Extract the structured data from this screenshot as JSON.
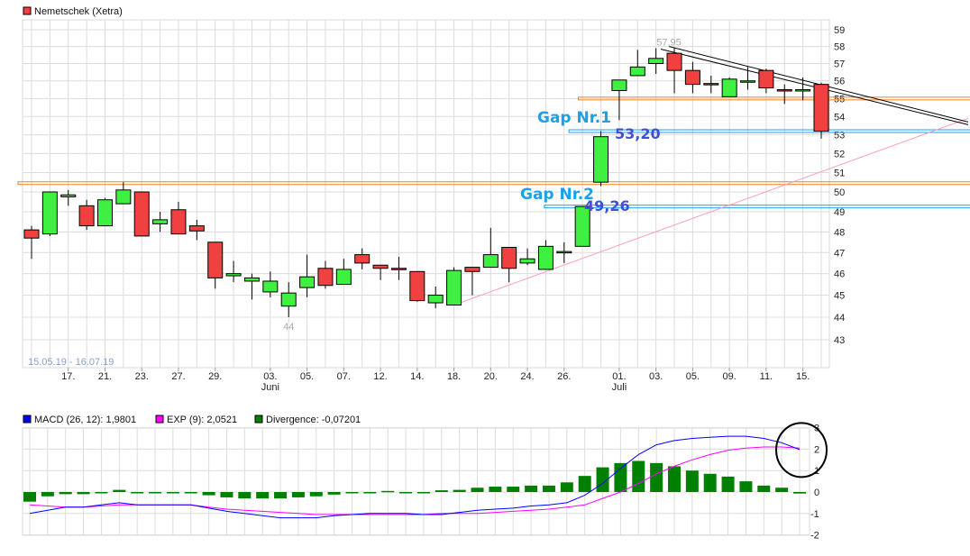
{
  "chart_data": [
    {
      "type": "candlestick",
      "legend": {
        "label": "Nemetschek (Xetra)",
        "color": "#f04040"
      },
      "date_range_label": "15.05.19 - 16.07.19",
      "y_scale": "log",
      "ylim": [
        42,
        59.5
      ],
      "y_ticks": [
        43,
        44,
        45,
        46,
        47,
        48,
        49,
        50,
        51,
        52,
        53,
        54,
        55,
        56,
        57,
        58,
        59
      ],
      "grid": true,
      "x_tick_labels": [
        {
          "i": 2,
          "label": "17."
        },
        {
          "i": 4,
          "label": "21."
        },
        {
          "i": 6,
          "label": "23."
        },
        {
          "i": 8,
          "label": "27."
        },
        {
          "i": 10,
          "label": "29."
        },
        {
          "i": 13,
          "label": "03."
        },
        {
          "i": 15,
          "label": "05."
        },
        {
          "i": 17,
          "label": "07."
        },
        {
          "i": 19,
          "label": "12."
        },
        {
          "i": 21,
          "label": "14."
        },
        {
          "i": 23,
          "label": "18."
        },
        {
          "i": 25,
          "label": "20."
        },
        {
          "i": 27,
          "label": "24."
        },
        {
          "i": 29,
          "label": "26."
        },
        {
          "i": 32,
          "label": "01."
        },
        {
          "i": 34,
          "label": "03."
        },
        {
          "i": 36,
          "label": "05."
        },
        {
          "i": 38,
          "label": "09."
        },
        {
          "i": 40,
          "label": "11."
        },
        {
          "i": 42,
          "label": "15."
        }
      ],
      "month_labels": [
        {
          "i": 13,
          "label": "Juni"
        },
        {
          "i": 32,
          "label": "Juli"
        }
      ],
      "up_color": "#40f040",
      "down_color": "#f04040",
      "ohlc": [
        [
          48.1,
          48.3,
          46.7,
          47.7
        ],
        [
          47.9,
          50.0,
          47.8,
          50.0
        ],
        [
          49.75,
          50.1,
          49.3,
          49.85
        ],
        [
          49.3,
          49.6,
          48.1,
          48.3
        ],
        [
          48.3,
          49.7,
          48.3,
          49.6
        ],
        [
          49.4,
          50.5,
          49.4,
          50.1
        ],
        [
          50.0,
          50.0,
          47.8,
          47.8
        ],
        [
          48.4,
          49.0,
          48.0,
          48.6
        ],
        [
          49.1,
          49.5,
          47.9,
          47.9
        ],
        [
          48.3,
          48.6,
          47.6,
          48.05
        ],
        [
          47.5,
          47.5,
          45.3,
          45.8
        ],
        [
          45.9,
          46.6,
          45.6,
          46.0
        ],
        [
          45.65,
          46.0,
          44.8,
          45.8
        ],
        [
          45.15,
          46.1,
          44.9,
          45.65
        ],
        [
          44.5,
          45.6,
          44.0,
          45.1
        ],
        [
          45.35,
          46.9,
          44.9,
          45.85
        ],
        [
          46.25,
          46.6,
          45.3,
          45.45
        ],
        [
          45.5,
          46.7,
          45.5,
          46.2
        ],
        [
          46.9,
          47.2,
          46.2,
          46.5
        ],
        [
          46.4,
          46.4,
          45.7,
          46.25
        ],
        [
          46.25,
          46.8,
          45.7,
          46.2
        ],
        [
          46.1,
          46.1,
          44.7,
          44.75
        ],
        [
          44.65,
          45.4,
          44.4,
          45.0
        ],
        [
          44.55,
          46.3,
          44.55,
          46.15
        ],
        [
          46.3,
          46.3,
          45.0,
          46.1
        ],
        [
          46.3,
          48.2,
          46.3,
          46.9
        ],
        [
          47.25,
          47.25,
          45.6,
          46.25
        ],
        [
          46.5,
          47.2,
          46.4,
          46.7
        ],
        [
          46.2,
          47.6,
          46.2,
          47.3
        ],
        [
          47.0,
          47.5,
          46.5,
          47.05
        ],
        [
          47.3,
          49.26,
          47.3,
          49.26
        ],
        [
          50.5,
          53.2,
          50.3,
          52.9
        ],
        [
          55.45,
          56.05,
          53.8,
          56.05
        ],
        [
          56.3,
          57.8,
          56.3,
          56.8
        ],
        [
          57.0,
          57.9,
          56.4,
          57.3
        ],
        [
          57.6,
          57.95,
          55.3,
          56.6
        ],
        [
          56.6,
          57.1,
          55.3,
          55.8
        ],
        [
          55.85,
          56.3,
          55.3,
          55.8
        ],
        [
          55.1,
          56.2,
          55.1,
          56.1
        ],
        [
          56.0,
          56.8,
          55.5,
          56.0
        ],
        [
          56.6,
          56.7,
          55.3,
          55.6
        ],
        [
          55.5,
          55.8,
          54.7,
          55.45
        ],
        [
          55.5,
          56.2,
          54.9,
          55.5
        ],
        [
          55.8,
          55.9,
          52.8,
          53.2
        ]
      ],
      "annotations": {
        "high_label": {
          "i": 35,
          "value": 57.95,
          "text": "57,95"
        },
        "low_label": {
          "i": 14,
          "value": 44.0,
          "text": "44"
        },
        "gap1": {
          "title": "Gap Nr.1",
          "value_text": "53,20",
          "value": 53.2,
          "from_i": 30,
          "color": "#1ea0e8"
        },
        "gap2": {
          "title": "Gap Nr.2",
          "value_text": "49,26",
          "value": 49.26,
          "from_i": 29,
          "color": "#1ea0e8"
        },
        "resistance_lines": [
          {
            "value": 55.0,
            "from_i": 31,
            "color": "#f08020"
          },
          {
            "value": 50.45,
            "from_i": -1,
            "color": "#f08020"
          }
        ],
        "downtrend": {
          "from_i": 34.7,
          "from_value": 57.95,
          "to_i": 51.0,
          "to_value": 53.7,
          "color": "#000000"
        },
        "uptrend": {
          "from_i": 23,
          "from_value": 44.55,
          "to_i": 51.0,
          "to_value": 53.9,
          "color": "#ff99bb"
        }
      }
    },
    {
      "type": "macd",
      "legend": [
        {
          "label": "MACD (26, 12): 1,9801",
          "color": "#0000ff"
        },
        {
          "label": "EXP (9): 2,0521",
          "color": "#ff00ff"
        },
        {
          "label": "Divergence: -0,07201",
          "color": "#008000"
        }
      ],
      "ylim": [
        -2,
        3
      ],
      "y_ticks": [
        -2,
        -1,
        0,
        1,
        2,
        3
      ],
      "grid": true,
      "macd": [
        -1.0,
        -0.85,
        -0.7,
        -0.7,
        -0.6,
        -0.5,
        -0.6,
        -0.6,
        -0.6,
        -0.6,
        -0.75,
        -0.9,
        -1.0,
        -1.1,
        -1.2,
        -1.2,
        -1.2,
        -1.1,
        -1.05,
        -1.0,
        -1.0,
        -1.0,
        -1.05,
        -1.05,
        -0.95,
        -0.85,
        -0.8,
        -0.75,
        -0.65,
        -0.6,
        -0.5,
        -0.15,
        0.4,
        1.1,
        1.75,
        2.2,
        2.4,
        2.5,
        2.55,
        2.6,
        2.6,
        2.5,
        2.3,
        1.98
      ],
      "signal": [
        -0.6,
        -0.65,
        -0.7,
        -0.7,
        -0.65,
        -0.6,
        -0.6,
        -0.6,
        -0.6,
        -0.6,
        -0.7,
        -0.8,
        -0.85,
        -0.9,
        -0.95,
        -1.0,
        -1.05,
        -1.05,
        -1.05,
        -1.05,
        -1.05,
        -1.05,
        -1.05,
        -1.0,
        -1.0,
        -1.0,
        -0.95,
        -0.9,
        -0.85,
        -0.8,
        -0.7,
        -0.6,
        -0.3,
        0.0,
        0.4,
        0.85,
        1.2,
        1.5,
        1.75,
        1.95,
        2.05,
        2.1,
        2.1,
        2.05
      ],
      "divergence": [
        -0.45,
        -0.2,
        -0.1,
        -0.1,
        -0.02,
        0.1,
        -0.02,
        -0.02,
        -0.05,
        -0.05,
        -0.15,
        -0.25,
        -0.3,
        -0.3,
        -0.3,
        -0.25,
        -0.2,
        -0.12,
        -0.04,
        -0.03,
        0.05,
        -0.03,
        -0.05,
        0.08,
        0.1,
        0.2,
        0.25,
        0.25,
        0.3,
        0.3,
        0.45,
        0.75,
        1.15,
        1.35,
        1.45,
        1.35,
        1.2,
        1.0,
        0.85,
        0.72,
        0.5,
        0.3,
        0.2,
        -0.07
      ],
      "highlight_circle": {
        "i": 43,
        "value": 2.0,
        "color": "#000000"
      }
    }
  ]
}
